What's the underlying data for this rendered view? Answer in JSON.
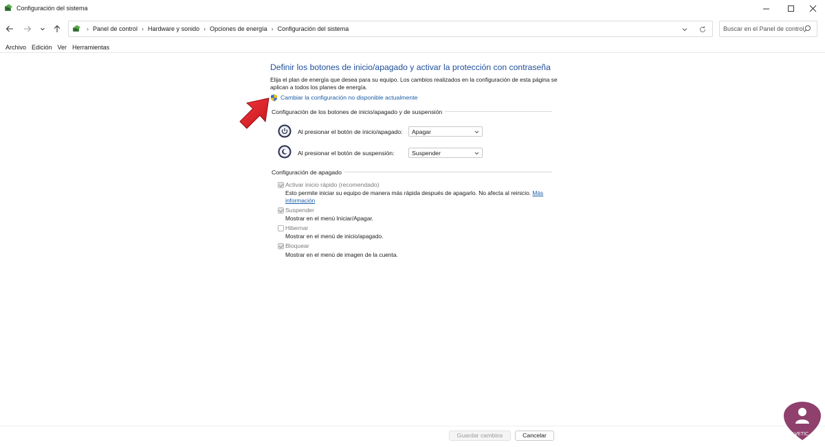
{
  "window": {
    "title": "Configuración del sistema"
  },
  "address_bar": {
    "breadcrumbs": [
      "Panel de control",
      "Hardware y sonido",
      "Opciones de energía",
      "Configuración del sistema"
    ],
    "search_placeholder": "Buscar en el Panel de control"
  },
  "menu": [
    "Archivo",
    "Edición",
    "Ver",
    "Herramientas"
  ],
  "content": {
    "heading": "Definir los botones de inicio/apagado y activar la protección con contraseña",
    "description": "Elija el plan de energía que desea para su equipo. Los cambios realizados en la configuración de esta página se aplican a todos los planes de energía.",
    "change_link": "Cambiar la configuración no disponible actualmente",
    "buttons_section": {
      "title": "Configuración de los botones de inicio/apagado y de suspensión",
      "rows": [
        {
          "label": "Al presionar el botón de inicio/apagado:",
          "value": "Apagar",
          "icon": "power-button-icon"
        },
        {
          "label": "Al presionar el botón de suspensión:",
          "value": "Suspender",
          "icon": "sleep-button-icon"
        }
      ]
    },
    "shutdown_section": {
      "title": "Configuración de apagado",
      "options": [
        {
          "label": "Activar inicio rápido (recomendado)",
          "checked": true,
          "desc": "Esto permite iniciar su equipo de manera más rápida después de apagarlo. No afecta al reinicio.",
          "link1": "Más",
          "link2": "información"
        },
        {
          "label": "Suspender",
          "checked": true,
          "desc": "Mostrar en el menú Iniciar/Apagar."
        },
        {
          "label": "Hibernar",
          "checked": false,
          "desc": "Mostrar en el menú de inicio/apagado."
        },
        {
          "label": "Bloquear",
          "checked": true,
          "desc": "Mostrar en el menú de imagen de la cuenta."
        }
      ]
    }
  },
  "footer": {
    "save_label": "Guardar cambios",
    "cancel_label": "Cancelar"
  },
  "watermark": {
    "text": "SOLVETIC"
  },
  "colors": {
    "heading": "#1e4e9a",
    "link": "#1a5ca8",
    "arrow": "#e8232b"
  }
}
